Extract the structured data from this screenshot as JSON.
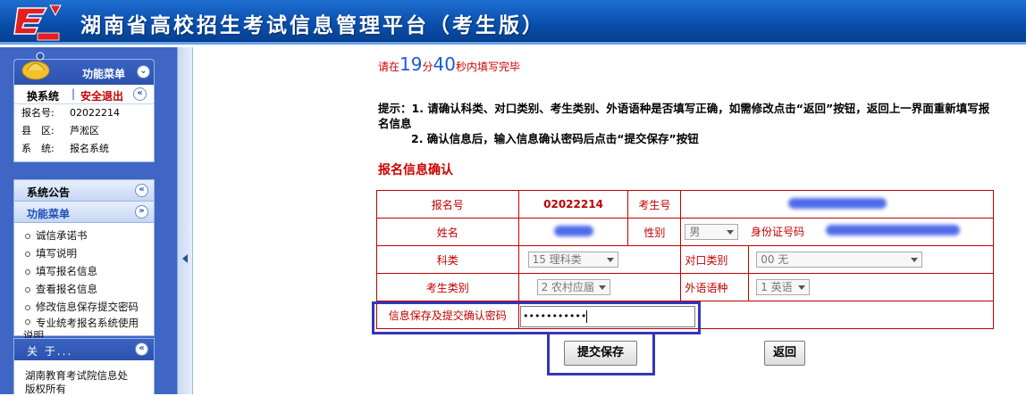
{
  "header": {
    "title": "湖南省高校招生考试信息管理平台（考生版）"
  },
  "sidebar": {
    "function_menu_title": "功能菜单",
    "switch_system": "换系统",
    "logout": "安全退出",
    "info": [
      {
        "label": "报名号:",
        "value": "02022214"
      },
      {
        "label": "县　区:",
        "value": "芦淞区"
      },
      {
        "label": "系　统:",
        "value": "报名系统"
      }
    ],
    "announcement_title": "系统公告",
    "menu_title": "功能菜单",
    "menu_items": [
      "诚信承诺书",
      "填写说明",
      "填写报名信息",
      "查看报名信息",
      "修改信息保存提交密码"
    ],
    "menu_item_wrap_a": "专业统考报名系统使用",
    "menu_item_wrap_b": "说明",
    "about_title": "关 于...",
    "about_text_1": "湖南教育考试院信息处",
    "about_text_2": "版权所有"
  },
  "timer": {
    "prefix": "请在",
    "minutes": "19",
    "min_unit": "分",
    "seconds": "40",
    "suffix": "秒内填写完毕"
  },
  "tips": {
    "line1": "提示：1. 请确认科类、对口类别、考生类别、外语语种是否填写正确，如需修改点击“返回”按钮，返回上一界面重新填写报名信息",
    "line2": "2. 确认信息后，输入信息确认密码后点击“提交保存”按钮"
  },
  "section_title": "报名信息确认",
  "form": {
    "reg_no_label": "报名号",
    "reg_no_value": "02022214",
    "exam_no_label": "考生号",
    "name_label": "姓名",
    "gender_label": "性别",
    "gender_value": "男",
    "id_label": "身份证号码",
    "subject_label": "科类",
    "subject_value": "15 理科类",
    "vocational_label": "对口类别",
    "vocational_value": "00 无",
    "category_label": "考生类别",
    "category_value": "2 农村应届",
    "language_label": "外语语种",
    "language_value": "1 英语",
    "password_label": "信息保存及提交确认密码",
    "password_value": "•••••••••••"
  },
  "buttons": {
    "submit": "提交保存",
    "back": "返回"
  },
  "colors": {
    "header_blue": "#0a4fae",
    "label_red": "#c00000",
    "highlight_box": "#3536b8"
  }
}
